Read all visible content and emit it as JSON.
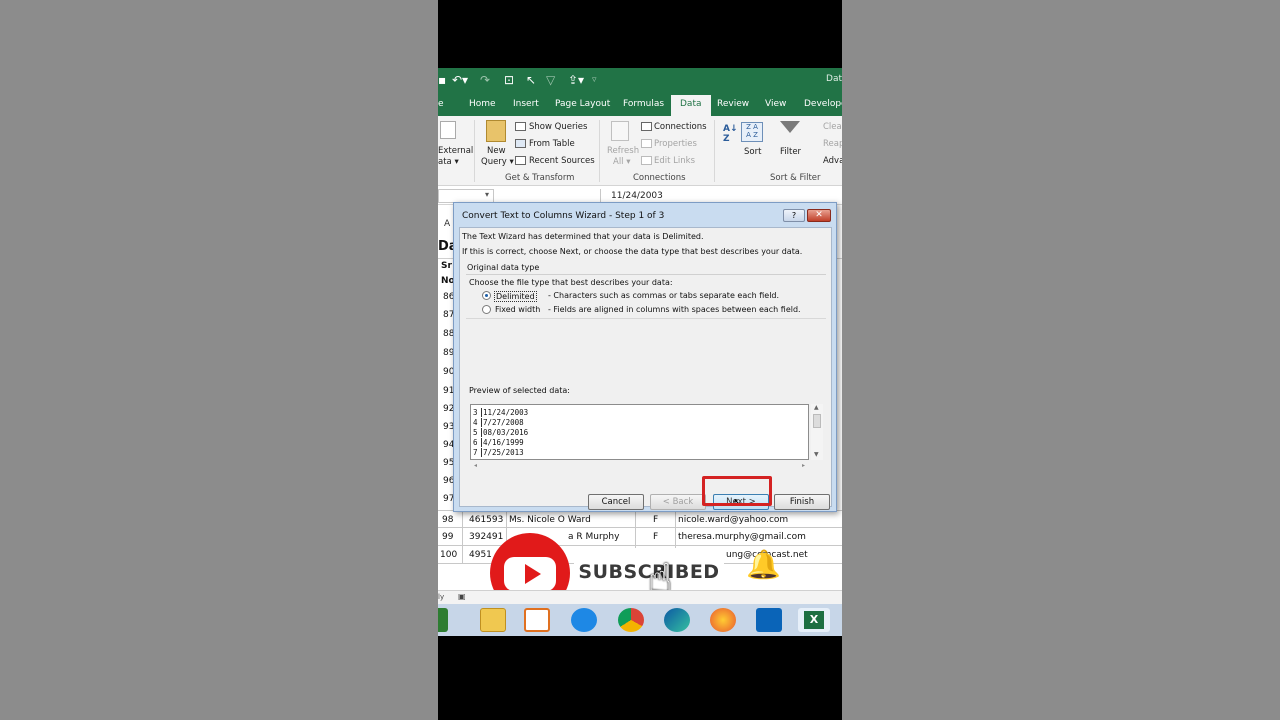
{
  "titlebar": {
    "doc_title": "Dat"
  },
  "tabs": [
    "e",
    "Home",
    "Insert",
    "Page Layout",
    "Formulas",
    "Data",
    "Review",
    "View",
    "Developer"
  ],
  "ribbon": {
    "external": [
      "External",
      "ata ▾"
    ],
    "new_query": [
      "New",
      "Query ▾"
    ],
    "get_transform": [
      "Show Queries",
      "From Table",
      "Recent Sources"
    ],
    "get_transform_label": "Get & Transform",
    "refresh": [
      "Refresh",
      "All ▾"
    ],
    "connections": [
      "Connections",
      "Properties",
      "Edit Links"
    ],
    "connections_label": "Connections",
    "sort": "Sort",
    "filter": "Filter",
    "clear": [
      "Clear",
      "Reap",
      "Adva"
    ],
    "sort_filter_label": "Sort & Filter"
  },
  "formula_bar": {
    "value": "11/24/2003"
  },
  "sheet": {
    "col_a": "A",
    "heading": "Da",
    "headers": [
      "Sr",
      "No"
    ],
    "row_numbers": [
      "86",
      "87",
      "88",
      "89",
      "90",
      "91",
      "92",
      "93",
      "94",
      "95",
      "96",
      "97"
    ]
  },
  "dialog": {
    "title": "Convert Text to Columns Wizard - Step 1 of 3",
    "help": "?",
    "close": "✕",
    "line1": "The Text Wizard has determined that your data is Delimited.",
    "line2": "If this is correct, choose Next, or choose the data type that best describes your data.",
    "section": "Original data type",
    "choose": "Choose the file type that best describes your data:",
    "delimited_label": "Delimited",
    "delimited_desc": "- Characters such as commas or tabs separate each field.",
    "fixed_label": "Fixed width",
    "fixed_desc": "- Fields are aligned in columns with spaces between each field.",
    "preview_label": "Preview of selected data:",
    "preview_rows": [
      {
        "n": "3",
        "text": "11/24/2003"
      },
      {
        "n": "4",
        "text": "7/27/2008"
      },
      {
        "n": "5",
        "text": "08/03/2016"
      },
      {
        "n": "6",
        "text": "4/16/1999"
      },
      {
        "n": "7",
        "text": "7/25/2013"
      }
    ],
    "cancel": "Cancel",
    "back": "< Back",
    "next": "Next >",
    "finish": "Finish"
  },
  "data_rows": [
    {
      "row": "98",
      "id": "461593",
      "name": "Ms. Nicole O Ward",
      "g": "F",
      "email": "nicole.ward@yahoo.com"
    },
    {
      "row": "99",
      "id": "392491",
      "name": "a R Murphy",
      "g": "F",
      "email": "theresa.murphy@gmail.com"
    },
    {
      "row": "100",
      "id": "4951",
      "name": "",
      "g": "",
      "email": "ung@comcast.net"
    }
  ],
  "overlay": {
    "subscribed": "SUBSCRIBED"
  },
  "status": {
    "mode": "ly"
  },
  "colors": {
    "excel_green": "#217346",
    "youtube_red": "#e11a1a",
    "highlight_red": "#d42222"
  }
}
